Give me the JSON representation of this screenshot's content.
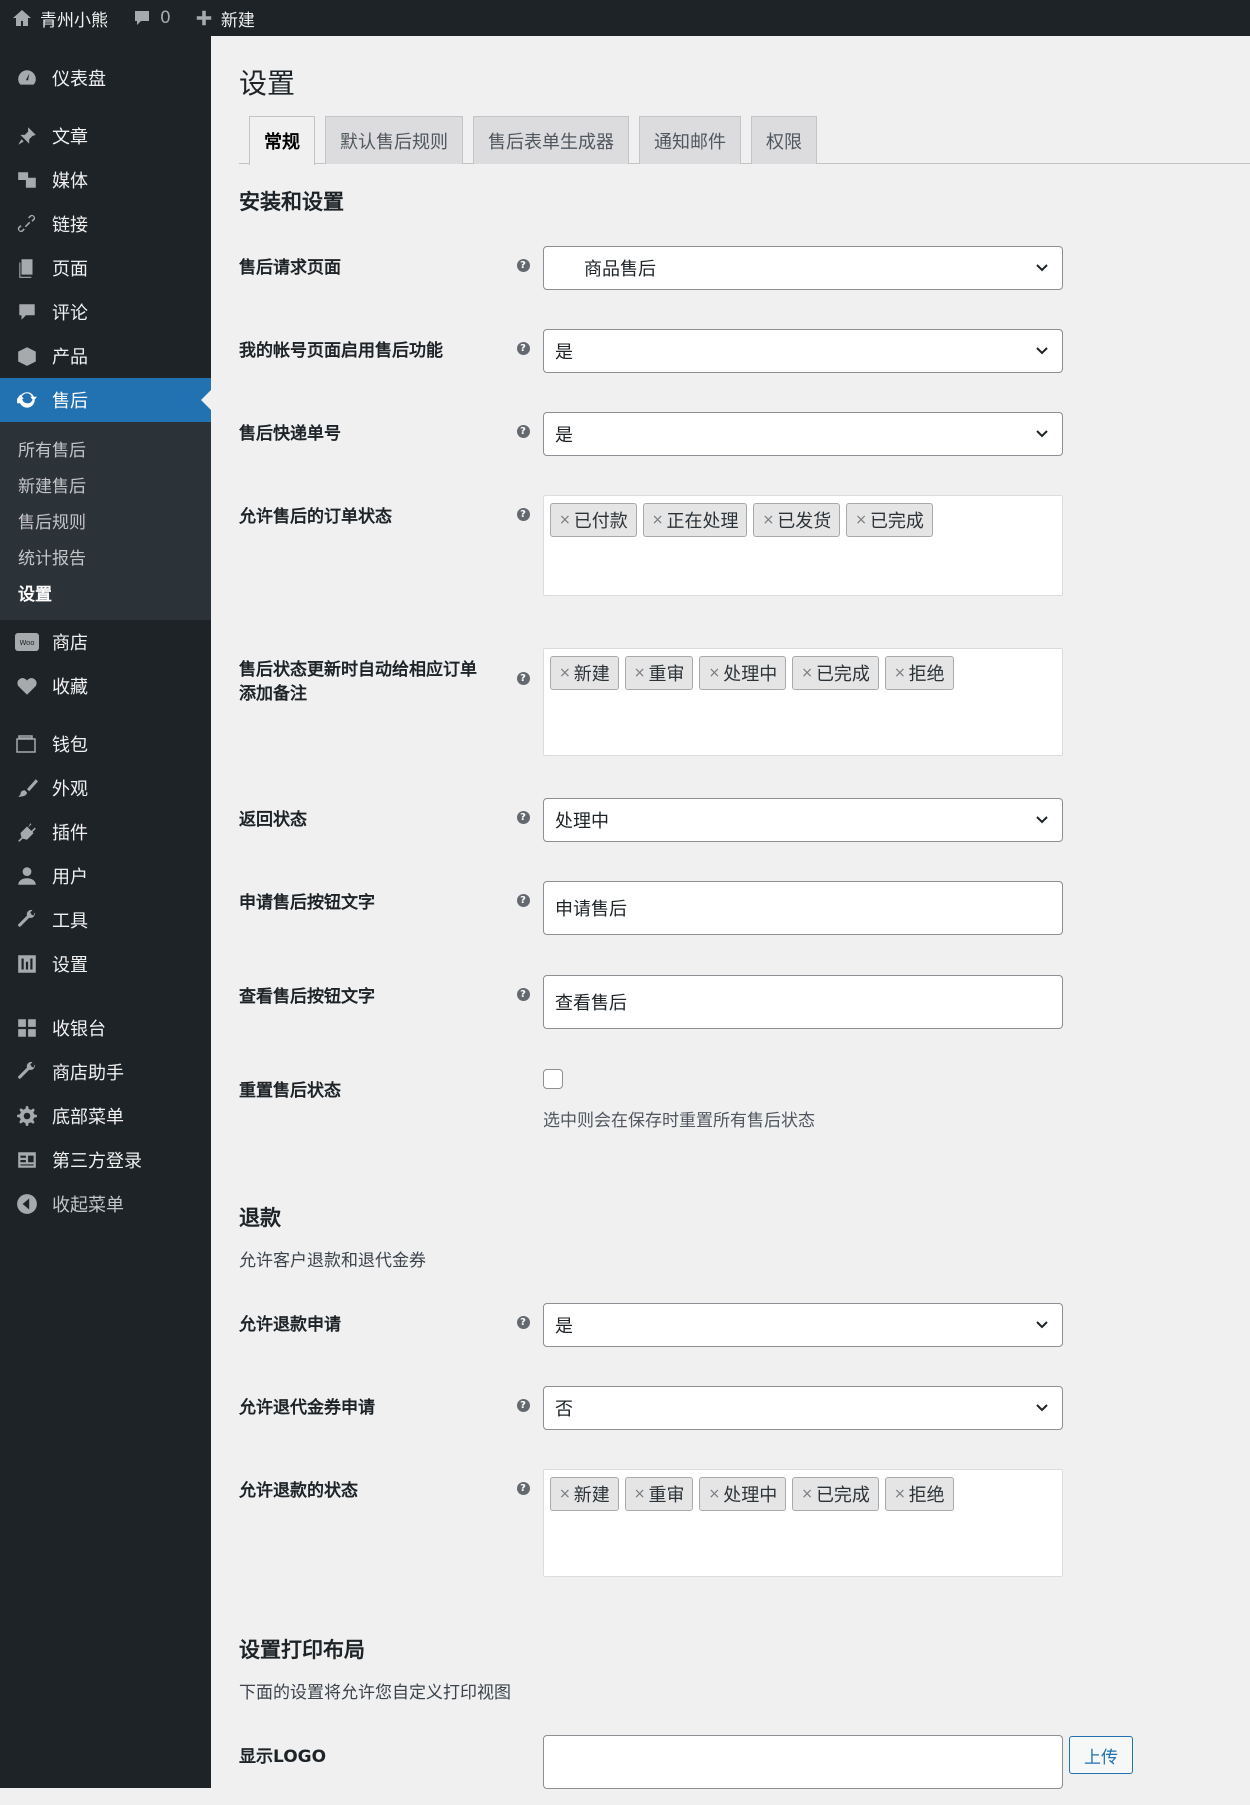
{
  "adminbar": {
    "site": "青州小熊",
    "comments": "0",
    "new": "新建"
  },
  "sidebar": {
    "dashboard": "仪表盘",
    "items1": [
      "文章",
      "媒体",
      "链接",
      "页面",
      "评论",
      "产品"
    ],
    "active": "售后",
    "sub": [
      "所有售后",
      "新建售后",
      "售后规则",
      "统计报告",
      "设置"
    ],
    "items2": [
      "商店",
      "收藏"
    ],
    "items3": [
      "钱包",
      "外观",
      "插件",
      "用户",
      "工具",
      "设置"
    ],
    "items4": [
      "收银台",
      "商店助手",
      "底部菜单",
      "第三方登录",
      "收起菜单"
    ]
  },
  "page": {
    "title": "设置"
  },
  "tabs": [
    "常规",
    "默认售后规则",
    "售后表单生成器",
    "通知邮件",
    "权限"
  ],
  "section1": {
    "title": "安装和设置",
    "fields": {
      "request_page": {
        "label": "售后请求页面",
        "value": "商品售后"
      },
      "myaccount": {
        "label": "我的帐号页面启用售后功能",
        "value": "是"
      },
      "tracking": {
        "label": "售后快递单号",
        "value": "是"
      },
      "order_status": {
        "label": "允许售后的订单状态",
        "tags": [
          "已付款",
          "正在处理",
          "已发货",
          "已完成"
        ]
      },
      "auto_note": {
        "label1": "售后状态更新时自动给相应订单",
        "label2": "添加备注",
        "tags": [
          "新建",
          "重审",
          "处理中",
          "已完成",
          "拒绝"
        ]
      },
      "return_status": {
        "label": "返回状态",
        "value": "处理中"
      },
      "apply_btn": {
        "label": "申请售后按钮文字",
        "value": "申请售后"
      },
      "view_btn": {
        "label": "查看售后按钮文字",
        "value": "查看售后"
      },
      "reset": {
        "label": "重置售后状态",
        "note": "选中则会在保存时重置所有售后状态"
      }
    }
  },
  "section2": {
    "title": "退款",
    "desc": "允许客户退款和退代金券",
    "fields": {
      "allow_refund": {
        "label": "允许退款申请",
        "value": "是"
      },
      "allow_coupon": {
        "label": "允许退代金券申请",
        "value": "否"
      },
      "refund_status": {
        "label": "允许退款的状态",
        "tags": [
          "新建",
          "重审",
          "处理中",
          "已完成",
          "拒绝"
        ]
      }
    }
  },
  "section3": {
    "title": "设置打印布局",
    "desc": "下面的设置将允许您自定义打印视图",
    "logo": {
      "label": "显示LOGO",
      "button": "上传"
    }
  }
}
